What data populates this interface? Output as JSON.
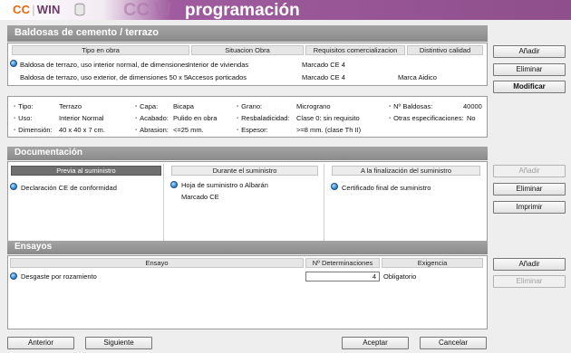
{
  "header": {
    "logo_cc": "CC",
    "logo_win": "WIN",
    "ghost_text": "CC W",
    "title": "programación"
  },
  "product": {
    "title": "Baldosas de cemento / terrazo",
    "columns": [
      "Tipo en obra",
      "Situacion Obra",
      "Requisitos comercializacion",
      "Distintivo calidad"
    ],
    "rows": [
      {
        "tipo": "Baldosa de terrazo, uso interior normal, de dimensiones",
        "situacion": "Interior de viviendas",
        "requisitos": "Marcado CE 4",
        "distintivo": ""
      },
      {
        "tipo": "Baldosa de terrazo, uso exterior, de dimensiones 50 x 5(",
        "situacion": "Accesos porticados",
        "requisitos": "Marcado CE 4",
        "distintivo": "Marca Aidico"
      }
    ]
  },
  "details": {
    "tipo_label": "Tipo:",
    "tipo_value": "Terrazo",
    "uso_label": "Uso:",
    "uso_value": "Interior Normal",
    "dim_label": "Dimensión:",
    "dim_value": "40 x 40 x 7 cm.",
    "capa_label": "Capa:",
    "capa_value": "Bicapa",
    "acabado_label": "Acabado:",
    "acabado_value": "Pulido en obra",
    "abrasion_label": "Abrasion:",
    "abrasion_value": "<=25 mm.",
    "grano_label": "Grano:",
    "grano_value": "Micrograno",
    "resbal_label": "Resbaladicidad:",
    "resbal_value": "Clase 0: sin requisito",
    "espesor_label": "Espesor:",
    "espesor_value": ">=8 mm. (clase Th II)",
    "nbaldosas_label": "Nº Baldosas:",
    "nbaldosas_value": "40000",
    "otras_label": "Otras especificaciones:",
    "otras_value": "No"
  },
  "documentacion": {
    "title": "Documentación",
    "previa_header": "Previa al suministro",
    "durante_header": "Durante el suministro",
    "final_header": "A la finalización del suministro",
    "previa_item": "Declaración CE de conformidad",
    "durante_item1": "Hoja de suministro o Albarán",
    "durante_item2": "Marcado CE",
    "final_item": "Certificado final de suministro"
  },
  "ensayos": {
    "title": "Ensayos",
    "columns": [
      "Ensayo",
      "Nº Determinaciones",
      "Exigencia"
    ],
    "rows": [
      {
        "ensayo": "Desgaste por rozamiento",
        "determinaciones": "4",
        "exigencia": "Obligatorio"
      }
    ]
  },
  "buttons": {
    "anadir": "Añadir",
    "eliminar": "Eliminar",
    "modificar": "Modificar",
    "imprimir": "Imprimir",
    "anterior": "Anterior",
    "siguiente": "Siguiente",
    "aceptar": "Aceptar",
    "cancelar": "Cancelar"
  }
}
